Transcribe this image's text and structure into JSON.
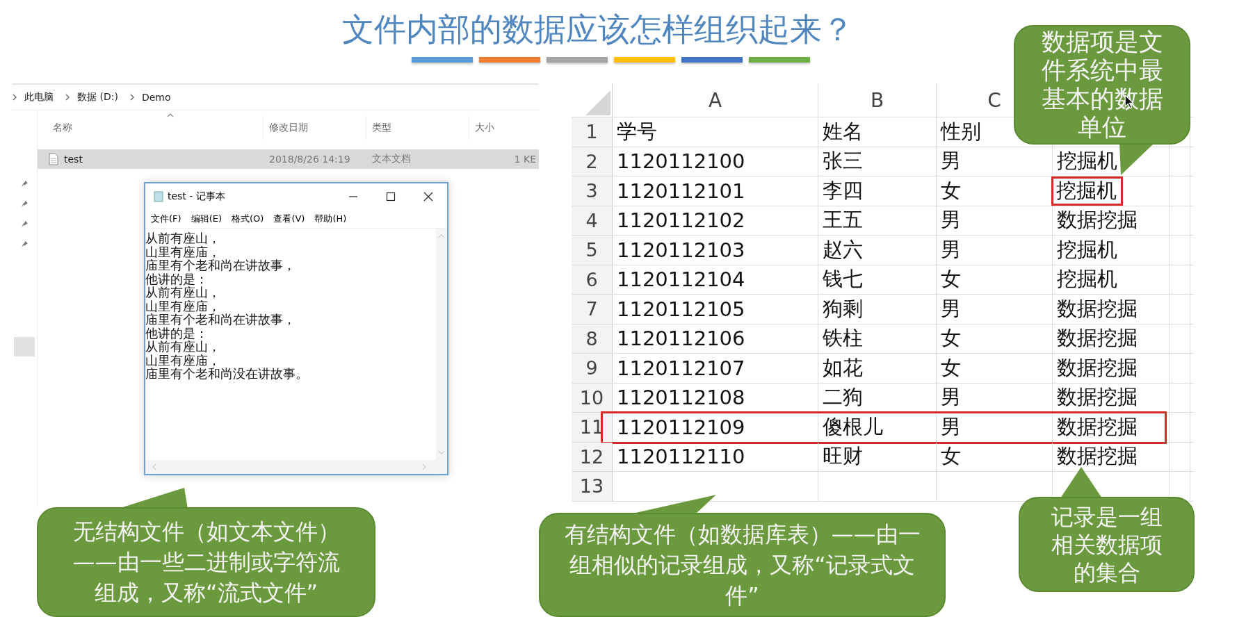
{
  "title": "文件内部的数据应该怎样组织起来？",
  "explorer": {
    "breadcrumb": [
      "此电脑",
      "数据 (D:)",
      "Demo"
    ],
    "columns": [
      "名称",
      "修改日期",
      "类型",
      "大小"
    ],
    "files": [
      {
        "name": "test",
        "date": "2018/8/26 14:19",
        "type": "文本文档",
        "size": "1 KE",
        "selected": true
      }
    ]
  },
  "notepad": {
    "title": "test - 记事本",
    "menu": [
      "文件(F)",
      "编辑(E)",
      "格式(O)",
      "查看(V)",
      "帮助(H)"
    ],
    "lines": [
      "从前有座山，",
      "山里有座庙，",
      "庙里有个老和尚在讲故事，",
      "他讲的是：",
      "从前有座山，",
      "山里有座庙，",
      "庙里有个老和尚在讲故事，",
      "他讲的是：",
      "从前有座山，",
      "山里有座庙，",
      "庙里有个老和尚没在讲故事。"
    ]
  },
  "sheet": {
    "columns": [
      "A",
      "B",
      "C"
    ],
    "rows": [
      {
        "number": "1",
        "cells": [
          "学号",
          "姓名",
          "性别"
        ],
        "row_outlined": false,
        "last_cell_outlined": false
      },
      {
        "number": "2",
        "cells": [
          "1120112100",
          "张三",
          "男",
          "挖掘机"
        ],
        "row_outlined": false,
        "last_cell_outlined": false
      },
      {
        "number": "3",
        "cells": [
          "1120112101",
          "李四",
          "女",
          "挖掘机"
        ],
        "row_outlined": false,
        "last_cell_outlined": true
      },
      {
        "number": "4",
        "cells": [
          "1120112102",
          "王五",
          "男",
          "数据挖掘"
        ],
        "row_outlined": false,
        "last_cell_outlined": false
      },
      {
        "number": "5",
        "cells": [
          "1120112103",
          "赵六",
          "男",
          "挖掘机"
        ],
        "row_outlined": false,
        "last_cell_outlined": false
      },
      {
        "number": "6",
        "cells": [
          "1120112104",
          "钱七",
          "女",
          "挖掘机"
        ],
        "row_outlined": false,
        "last_cell_outlined": false
      },
      {
        "number": "7",
        "cells": [
          "1120112105",
          "狗剩",
          "男",
          "数据挖掘"
        ],
        "row_outlined": false,
        "last_cell_outlined": false
      },
      {
        "number": "8",
        "cells": [
          "1120112106",
          "铁柱",
          "女",
          "数据挖掘"
        ],
        "row_outlined": false,
        "last_cell_outlined": false
      },
      {
        "number": "9",
        "cells": [
          "1120112107",
          "如花",
          "女",
          "数据挖掘"
        ],
        "row_outlined": false,
        "last_cell_outlined": false
      },
      {
        "number": "10",
        "cells": [
          "1120112108",
          "二狗",
          "男",
          "数据挖掘"
        ],
        "row_outlined": false,
        "last_cell_outlined": false
      },
      {
        "number": "11",
        "cells": [
          "1120112109",
          "傻根儿",
          "男",
          "数据挖掘"
        ],
        "row_outlined": true,
        "last_cell_outlined": false
      },
      {
        "number": "12",
        "cells": [
          "1120112110",
          "旺财",
          "女",
          "数据挖掘"
        ],
        "row_outlined": false,
        "last_cell_outlined": false
      },
      {
        "number": "13",
        "cells": [],
        "row_outlined": false,
        "last_cell_outlined": false
      }
    ]
  },
  "callouts": [
    {
      "text": "数据项是文件系统中最基本的数据单位"
    },
    {
      "text": "无结构文件（如文本文件）——由一些二进制或字符流组成，又称“流式文件”"
    },
    {
      "text": "有结构文件（如数据库表）——由一组相似的记录组成，又称“记录式文件”"
    },
    {
      "text": "记录是一组相关数据项的集合"
    }
  ]
}
